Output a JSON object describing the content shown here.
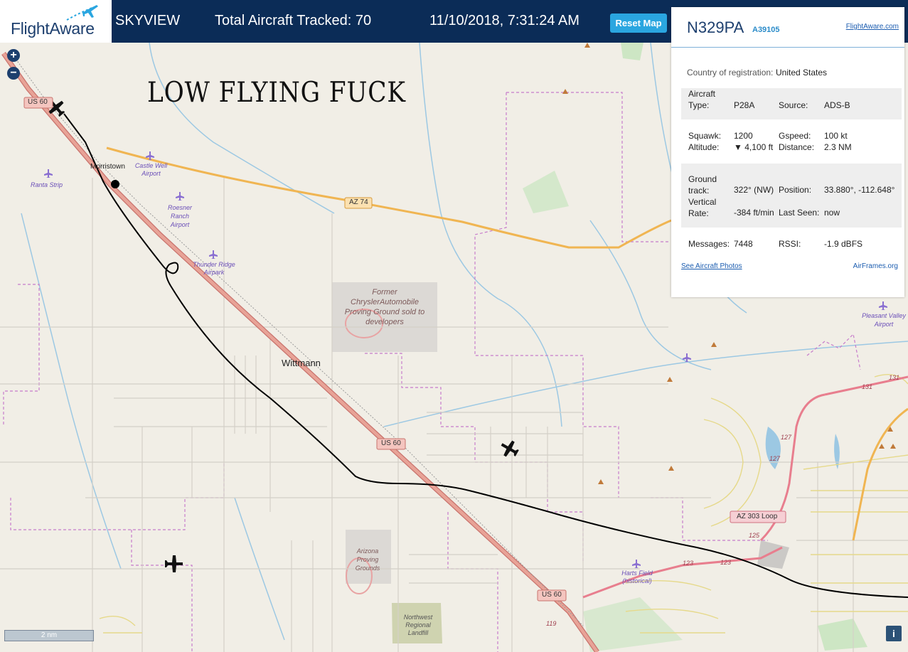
{
  "header": {
    "logo_text": "FlightAware",
    "app_name": "SKYVIEW",
    "aircraft_count_label": "Total Aircraft Tracked: 70",
    "datetime": "11/10/2018, 7:31:24 AM",
    "reset_button": "Reset Map"
  },
  "map": {
    "zoom_in": "+",
    "zoom_out": "−",
    "caption": "LOW FLYING FUCK",
    "scale": "2 nm",
    "info_button": "i",
    "places": {
      "morristown": "Morristown",
      "wittmann": "Wittmann",
      "ranta": "Ranta Strip",
      "castle_well": "Castle Well Airport",
      "roesner": "Roesner Ranch Airport",
      "thunder": "Thunder Ridge Airpark",
      "chrysler": "Former ChryslerAutomobile Proving Ground sold to developers",
      "arizona_pg": "Arizona Proving Grounds",
      "landfill": "Northwest Regional Landfill",
      "harts": "Harts Field (historical)",
      "pleasant": "Pleasant Valley Airport"
    },
    "shields": {
      "us60_a": "US 60",
      "us60_b": "US 60",
      "us60_c": "US 60",
      "az74": "AZ 74",
      "az303": "AZ 303 Loop"
    },
    "route_numbers": {
      "r131a": "131",
      "r131b": "131",
      "r127a": "127",
      "r127b": "127",
      "r125": "125",
      "r123a": "123",
      "r123b": "123",
      "r119": "119"
    },
    "icons": {
      "plane": "plane-icon",
      "airport": "airport-icon",
      "peak": "peak-icon"
    },
    "colors": {
      "track": "#000000",
      "highway": "#e3908a",
      "state_route": "#f0b552",
      "boundary": "#c77ccb",
      "water": "#9cc8e3"
    }
  },
  "panel": {
    "tail_number": "N329PA",
    "hex_code": "A39105",
    "fa_link": "FlightAware.com",
    "country_label": "Country of registration:",
    "country_value": "United States",
    "type_label": "Aircraft Type:",
    "type_value": "P28A",
    "source_label": "Source:",
    "source_value": "ADS-B",
    "squawk_label": "Squawk:",
    "squawk_value": "1200",
    "gspeed_label": "Gspeed:",
    "gspeed_value": "100 kt",
    "altitude_label": "Altitude:",
    "altitude_value": "▼ 4,100 ft",
    "distance_label": "Distance:",
    "distance_value": "2.3 NM",
    "track_label": "Ground track:",
    "track_value": "322° (NW)",
    "position_label": "Position:",
    "position_value": "33.880°, -112.648°",
    "vrate_label": "Vertical Rate:",
    "vrate_value": "-384 ft/min",
    "lastseen_label": "Last Seen:",
    "lastseen_value": "now",
    "messages_label": "Messages:",
    "messages_value": "7448",
    "rssi_label": "RSSI:",
    "rssi_value": "-1.9 dBFS",
    "photos_link": "See Aircraft Photos",
    "airframes_link": "AirFrames.org"
  }
}
